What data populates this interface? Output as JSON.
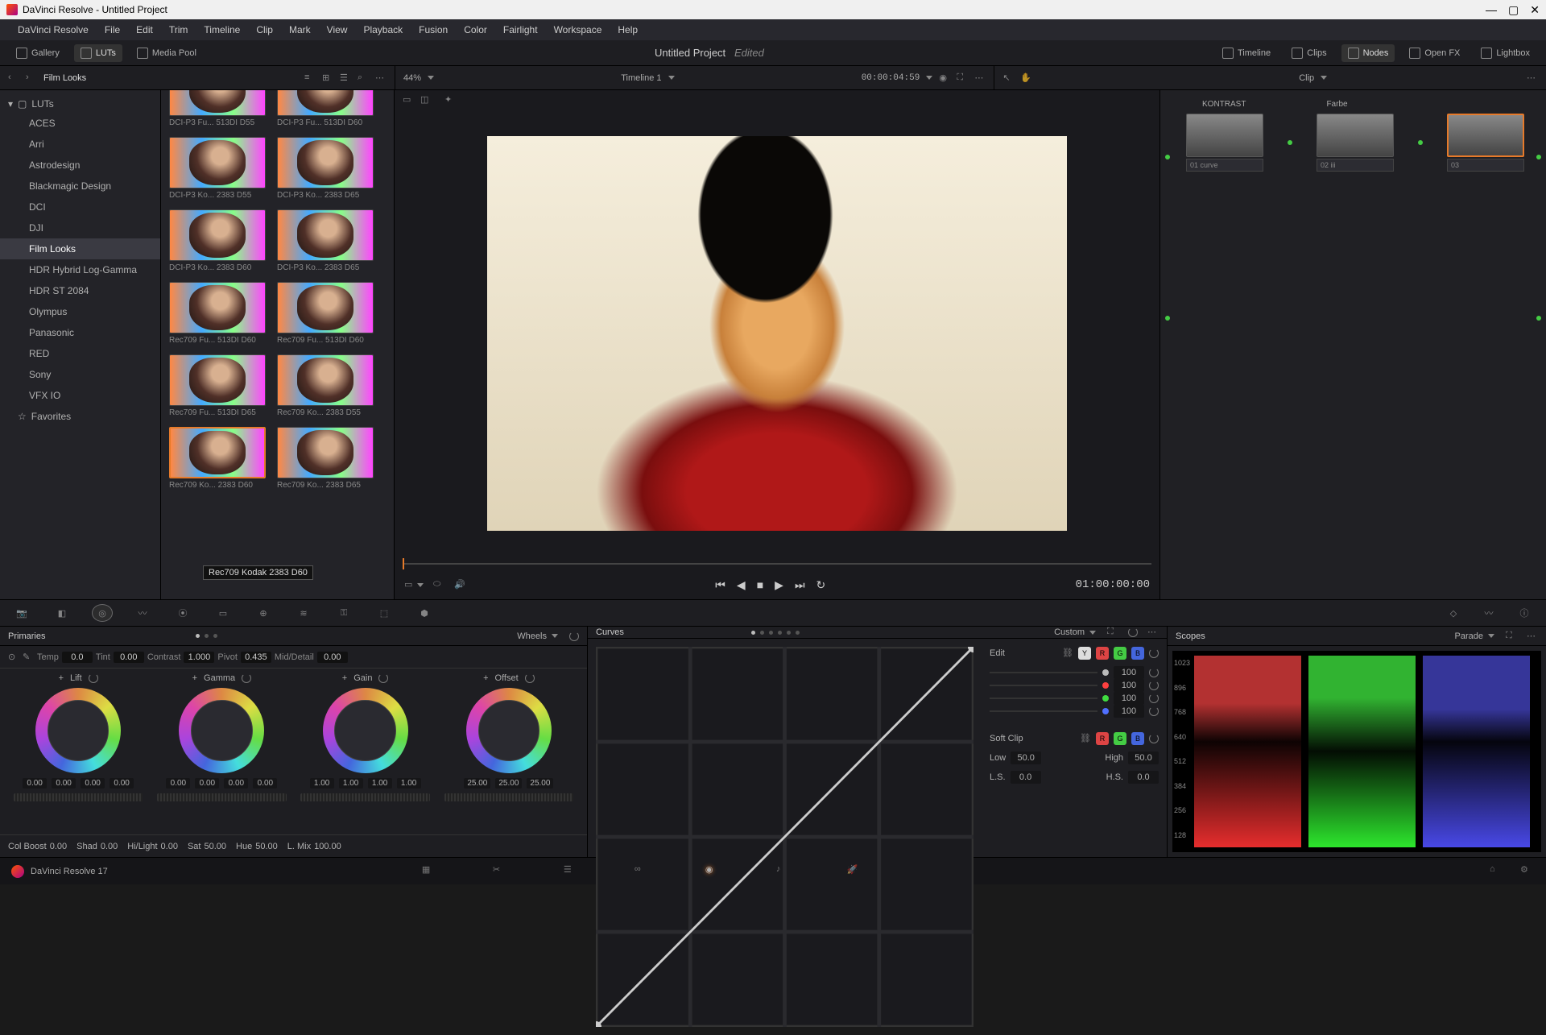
{
  "titlebar": {
    "text": "DaVinci Resolve - Untitled Project"
  },
  "menubar": [
    "DaVinci Resolve",
    "File",
    "Edit",
    "Trim",
    "Timeline",
    "Clip",
    "Mark",
    "View",
    "Playback",
    "Fusion",
    "Color",
    "Fairlight",
    "Workspace",
    "Help"
  ],
  "toptools": {
    "left": [
      {
        "icon": "gallery-icon",
        "label": "Gallery"
      },
      {
        "icon": "luts-icon",
        "label": "LUTs",
        "active": true
      },
      {
        "icon": "media-pool-icon",
        "label": "Media Pool"
      }
    ],
    "project": "Untitled Project",
    "edited": "Edited",
    "right": [
      {
        "icon": "timeline-icon",
        "label": "Timeline"
      },
      {
        "icon": "clips-icon",
        "label": "Clips"
      },
      {
        "icon": "nodes-icon",
        "label": "Nodes",
        "active": true
      },
      {
        "icon": "openfx-icon",
        "label": "Open FX"
      },
      {
        "icon": "lightbox-icon",
        "label": "Lightbox"
      }
    ]
  },
  "headerrow": {
    "browser_title": "Film Looks",
    "zoom": "44%",
    "timeline": "Timeline 1",
    "source_tc": "00:00:04:59",
    "mode": "Clip"
  },
  "sidebar": {
    "root": "LUTs",
    "items": [
      "ACES",
      "Arri",
      "Astrodesign",
      "Blackmagic Design",
      "DCI",
      "DJI",
      "Film Looks",
      "HDR Hybrid Log-Gamma",
      "HDR ST 2084",
      "Olympus",
      "Panasonic",
      "RED",
      "Sony",
      "VFX IO"
    ],
    "selected": "Film Looks",
    "favorites": "Favorites"
  },
  "luts": {
    "rows": [
      [
        "DCI-P3 Fu... 513DI D55",
        "DCI-P3 Fu... 513DI D60"
      ],
      [
        "DCI-P3 Ko... 2383 D55",
        "DCI-P3 Ko... 2383 D65"
      ],
      [
        "DCI-P3 Ko... 2383 D60",
        "DCI-P3 Ko... 2383 D65"
      ],
      [
        "Rec709 Fu... 513DI D60",
        "Rec709 Fu... 513DI D60"
      ],
      [
        "Rec709 Fu... 513DI D65",
        "Rec709 Ko... 2383 D55"
      ],
      [
        "Rec709 Ko... 2383 D60",
        "Rec709 Ko... 2383 D65"
      ]
    ],
    "selected_index": [
      5,
      0
    ],
    "tooltip": "Rec709 Kodak 2383 D60"
  },
  "viewer": {
    "playhead_tc": "01:00:00:00"
  },
  "nodes": {
    "labels": [
      "KONTRAST",
      "Farbe"
    ],
    "items": [
      {
        "id": "01",
        "badge": "curve"
      },
      {
        "id": "02",
        "badge": "iii"
      },
      {
        "id": "03",
        "badge": ""
      }
    ],
    "selected": 2
  },
  "iconstrip": [
    "camera-raw",
    "color-match",
    "color-wheels",
    "hue-curves",
    "qualifier",
    "window",
    "tracker",
    "blur",
    "key",
    "sizing",
    "3d"
  ],
  "primaries": {
    "title": "Primaries",
    "wheels_label": "Wheels",
    "sliders": [
      {
        "lbl": "Temp",
        "val": "0.0"
      },
      {
        "lbl": "Tint",
        "val": "0.00"
      },
      {
        "lbl": "Contrast",
        "val": "1.000"
      },
      {
        "lbl": "Pivot",
        "val": "0.435"
      },
      {
        "lbl": "Mid/Detail",
        "val": "0.00"
      }
    ],
    "wheels": [
      {
        "name": "Lift",
        "nums": [
          "0.00",
          "0.00",
          "0.00",
          "0.00"
        ]
      },
      {
        "name": "Gamma",
        "nums": [
          "0.00",
          "0.00",
          "0.00",
          "0.00"
        ]
      },
      {
        "name": "Gain",
        "nums": [
          "1.00",
          "1.00",
          "1.00",
          "1.00"
        ]
      },
      {
        "name": "Offset",
        "nums": [
          "25.00",
          "25.00",
          "25.00"
        ]
      }
    ],
    "footer": [
      {
        "lbl": "Col Boost",
        "val": "0.00"
      },
      {
        "lbl": "Shad",
        "val": "0.00"
      },
      {
        "lbl": "Hi/Light",
        "val": "0.00"
      },
      {
        "lbl": "Sat",
        "val": "50.00"
      },
      {
        "lbl": "Hue",
        "val": "50.00"
      },
      {
        "lbl": "L. Mix",
        "val": "100.00"
      }
    ]
  },
  "curves": {
    "title": "Curves",
    "mode": "Custom",
    "edit": "Edit",
    "channels": [
      "Y",
      "R",
      "G",
      "B"
    ],
    "values": [
      "100",
      "100",
      "100",
      "100"
    ],
    "dot_colors": [
      "#bbbbbb",
      "#ff4040",
      "#40dd40",
      "#5070ff"
    ],
    "softclip": "Soft Clip",
    "low": {
      "lbl": "Low",
      "val": "50.0"
    },
    "high": {
      "lbl": "High",
      "val": "50.0"
    },
    "ls": {
      "lbl": "L.S.",
      "val": "0.0"
    },
    "hs": {
      "lbl": "H.S.",
      "val": "0.0"
    }
  },
  "scopes": {
    "title": "Scopes",
    "mode": "Parade",
    "ylabels": [
      "1023",
      "896",
      "768",
      "640",
      "512",
      "384",
      "256",
      "128"
    ]
  },
  "pageswitch": {
    "app": "DaVinci Resolve 17",
    "pages": [
      "media",
      "cut",
      "edit",
      "fusion",
      "color",
      "fairlight",
      "deliver"
    ],
    "active": "color"
  }
}
